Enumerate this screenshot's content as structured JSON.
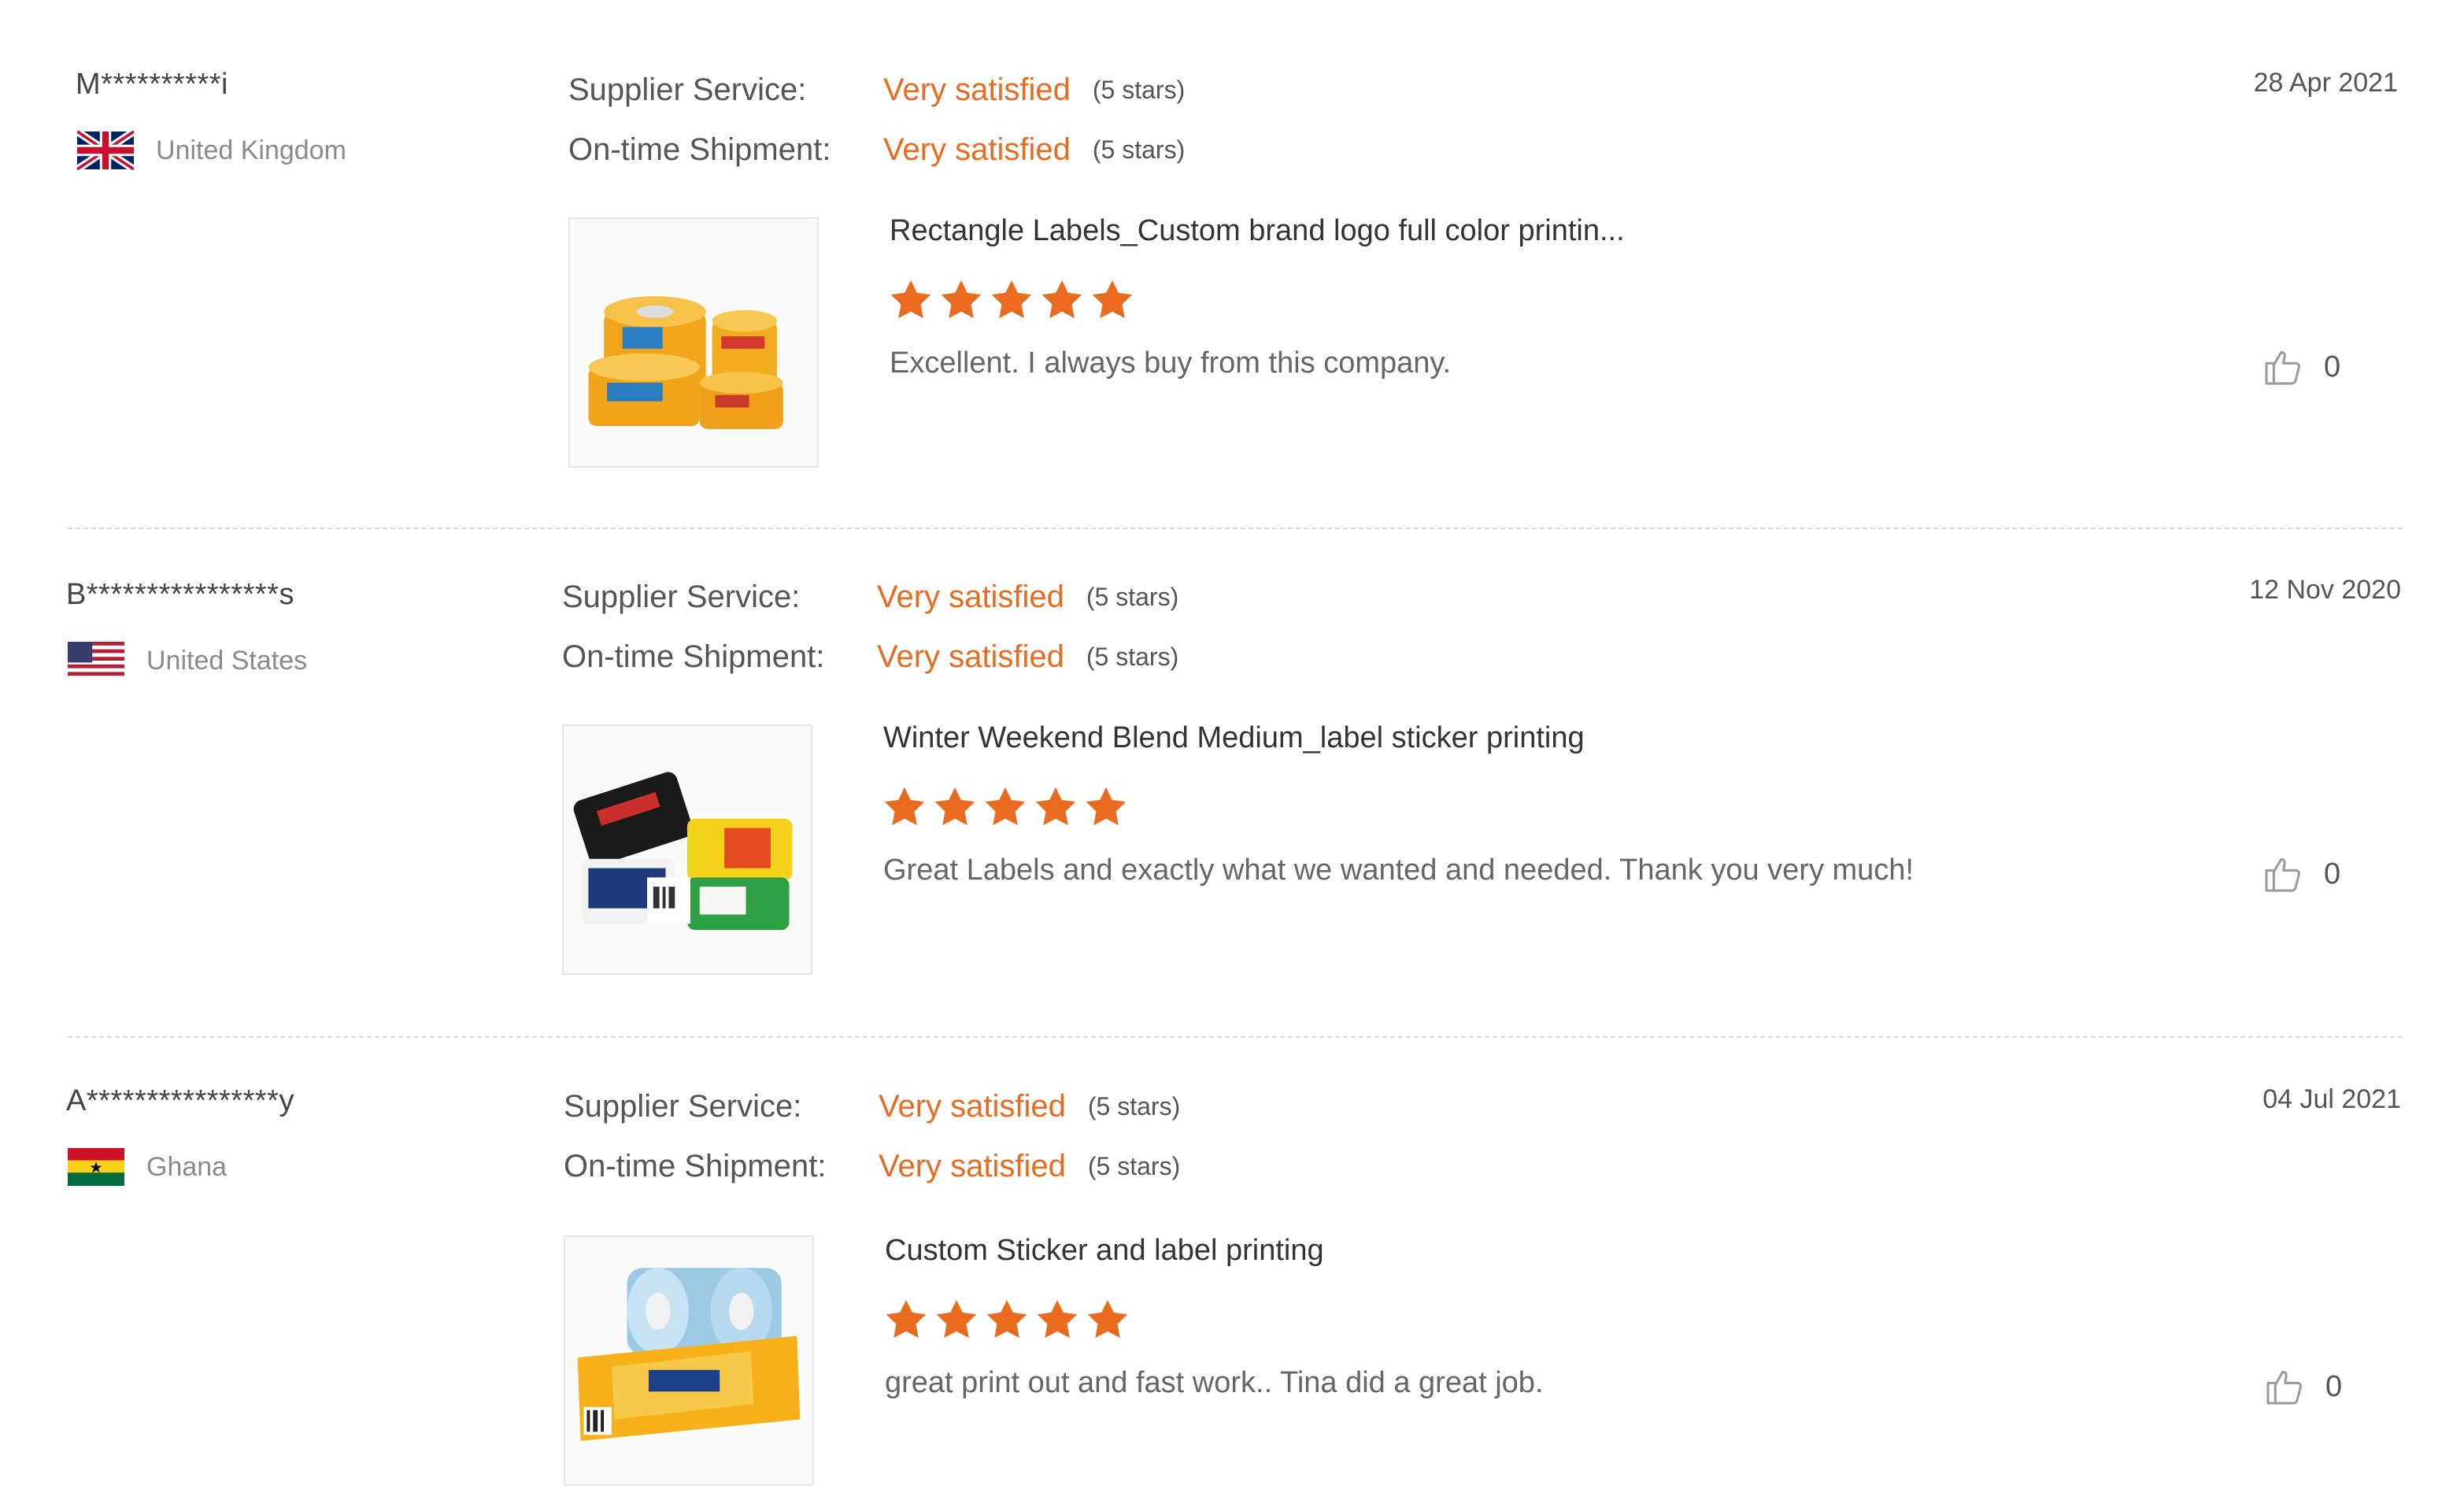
{
  "colors": {
    "accent": "#ea6a1f",
    "divider": "#d8d8d8",
    "muted": "#8a8a8a"
  },
  "icons": {
    "rating_star": "star-icon",
    "like": "thumbs-up-icon"
  },
  "reviews": [
    {
      "buyer": "M**********i",
      "country": "United Kingdom",
      "flag": "uk-flag-icon",
      "supplier_label": "Supplier Service:",
      "supplier_value": "Very satisfied",
      "supplier_note": "(5 stars)",
      "shipment_label": "On-time Shipment:",
      "shipment_value": "Very satisfied",
      "shipment_note": "(5 stars)",
      "date": "28 Apr 2021",
      "product": "Rectangle Labels_Custom brand logo full color printin...",
      "stars": 5,
      "text": "Excellent. I always buy from this company.",
      "likes": "0"
    },
    {
      "buyer": "B****************s",
      "country": "United States",
      "flag": "us-flag-icon",
      "supplier_label": "Supplier Service:",
      "supplier_value": "Very satisfied",
      "supplier_note": "(5 stars)",
      "shipment_label": "On-time Shipment:",
      "shipment_value": "Very satisfied",
      "shipment_note": "(5 stars)",
      "date": "12 Nov 2020",
      "product": "Winter Weekend Blend Medium_label sticker printing",
      "stars": 5,
      "text": "Great Labels and exactly what we wanted and needed. Thank you very much!",
      "likes": "0"
    },
    {
      "buyer": "A****************y",
      "country": "Ghana",
      "flag": "ghana-flag-icon",
      "supplier_label": "Supplier Service:",
      "supplier_value": "Very satisfied",
      "supplier_note": "(5 stars)",
      "shipment_label": "On-time Shipment:",
      "shipment_value": "Very satisfied",
      "shipment_note": "(5 stars)",
      "date": "04 Jul 2021",
      "product": "Custom Sticker and label printing",
      "stars": 5,
      "text": "great print out and fast work.. Tina did a great job.",
      "likes": "0"
    }
  ]
}
